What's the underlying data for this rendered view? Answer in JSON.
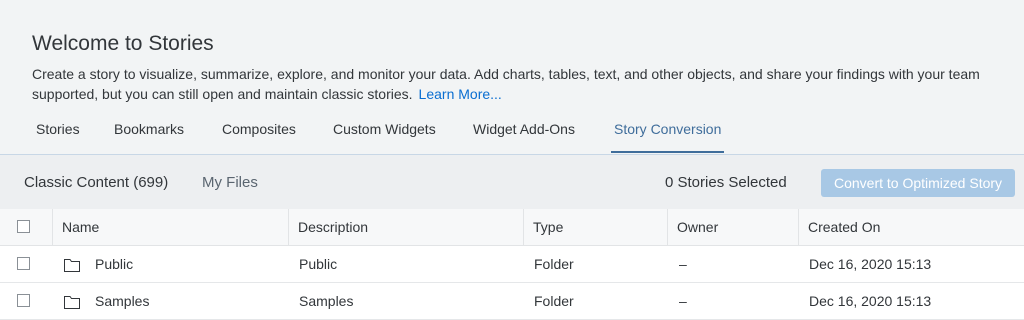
{
  "header": {
    "title": "Welcome to Stories",
    "description_line1": "Create a story to visualize, summarize, explore, and monitor your data. Add charts, tables, text, and other objects, and share your findings with your team",
    "description_line2": "supported, but you can still open and maintain classic stories.",
    "learn_more": "Learn More..."
  },
  "tabs": [
    {
      "label": "Stories",
      "active": false
    },
    {
      "label": "Bookmarks",
      "active": false
    },
    {
      "label": "Composites",
      "active": false
    },
    {
      "label": "Custom Widgets",
      "active": false
    },
    {
      "label": "Widget Add-Ons",
      "active": false
    },
    {
      "label": "Story Conversion",
      "active": true
    }
  ],
  "toolbar": {
    "classic_content": "Classic Content (699)",
    "my_files": "My Files",
    "selected": "0 Stories Selected",
    "convert_button": "Convert to Optimized Story"
  },
  "table": {
    "columns": [
      "Name",
      "Description",
      "Type",
      "Owner",
      "Created On"
    ],
    "rows": [
      {
        "icon": "folder-icon",
        "name": "Public",
        "description": "Public",
        "type": "Folder",
        "owner": "–",
        "created": "Dec 16, 2020 15:13"
      },
      {
        "icon": "folder-icon",
        "name": "Samples",
        "description": "Samples",
        "type": "Folder",
        "owner": "–",
        "created": "Dec 16, 2020 15:13"
      }
    ]
  },
  "colors": {
    "accent": "#3f6d9b",
    "link": "#0a6ed1",
    "button_disabled": "#a8c8e5"
  }
}
